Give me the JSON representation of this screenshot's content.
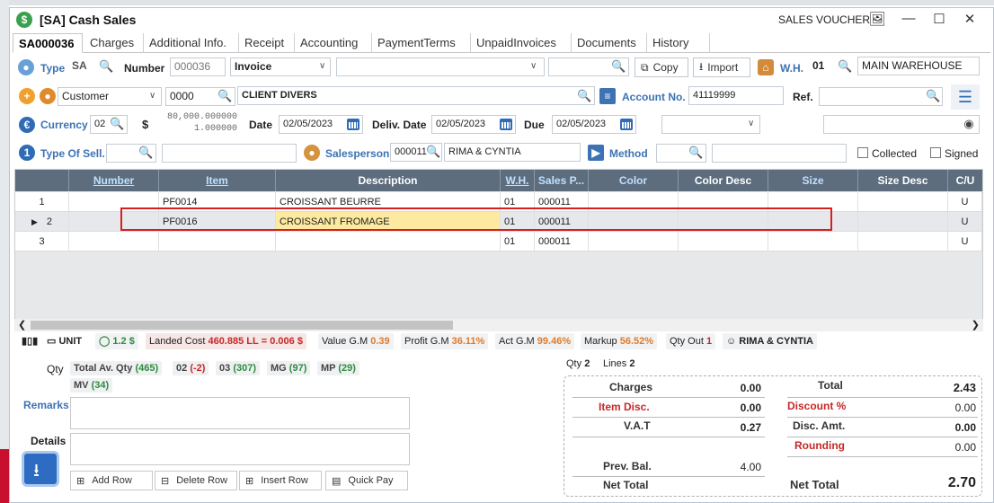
{
  "title": {
    "text": "[SA] Cash Sales",
    "voucher": "SALES VOUCHER"
  },
  "tabs": [
    "SA000036",
    "Charges",
    "Additional Info.",
    "Receipt",
    "Accounting",
    "PaymentTerms",
    "UnpaidInvoices",
    "Documents",
    "History"
  ],
  "form": {
    "type_label": "Type",
    "type_value": "SA",
    "number_label": "Number",
    "number_value": "000036",
    "invoice_value": "Invoice",
    "copy_label": "Copy",
    "import_label": "Import",
    "wh_label": "W.H.",
    "wh_value": "01",
    "wh_name": "MAIN WAREHOUSE",
    "customer_value": "Customer",
    "customer_code": "0000",
    "customer_name": "CLIENT DIVERS",
    "account_label": "Account No.",
    "account_value": "41119999",
    "ref_label": "Ref.",
    "currency_label": "Currency",
    "currency_value": "02",
    "currency_symbol": "$",
    "rate_1": "80,000.000000",
    "rate_2": "1.000000",
    "date_label": "Date",
    "date_value": "02/05/2023",
    "deliv_label": "Deliv. Date",
    "deliv_value": "02/05/2023",
    "due_label": "Due",
    "due_value": "02/05/2023",
    "typesell_label": "Type Of Sell.",
    "salesperson_label": "Salesperson",
    "salesperson_code": "000011",
    "salesperson_name": "RIMA & CYNTIA",
    "method_label": "Method",
    "collected_label": "Collected",
    "signed_label": "Signed"
  },
  "grid": {
    "columns": [
      "",
      "Number",
      "Item",
      "Description",
      "W.H.",
      "Sales P...",
      "Color",
      "Color Desc",
      "Size",
      "Size Desc",
      "C/U"
    ],
    "rows": [
      [
        "1",
        "",
        "PF0014",
        "CROISSANT BEURRE",
        "01",
        "000011",
        "",
        "",
        "",
        "",
        "U"
      ],
      [
        "2",
        "",
        "PF0016",
        "CROISSANT FROMAGE",
        "01",
        "000011",
        "",
        "",
        "",
        "",
        "U"
      ],
      [
        "3",
        "",
        "",
        "",
        "01",
        "000011",
        "",
        "",
        "",
        "",
        "U"
      ]
    ]
  },
  "stats": {
    "unit": "UNIT",
    "units_value": "1.2 $",
    "landed_label": "Landed Cost",
    "landed_value": "460.885 LL",
    "landed_eq": "= 0.006 $",
    "valuegm_label": "Value G.M",
    "valuegm_value": "0.39",
    "profitgm_label": "Profit G.M",
    "profitgm_value": "36.11%",
    "actgm_label": "Act G.M",
    "actgm_value": "99.46%",
    "markup_label": "Markup",
    "markup_value": "56.52%",
    "qtyout_label": "Qty Out",
    "qtyout_value": "1",
    "person": "RIMA & CYNTIA"
  },
  "qty": {
    "label": "Qty",
    "chips": [
      {
        "name": "Total Av. Qty",
        "val": "(465)"
      },
      {
        "name": "02",
        "val": "(-2)"
      },
      {
        "name": "03",
        "val": "(307)"
      },
      {
        "name": "MG",
        "val": "(97)"
      },
      {
        "name": "MP",
        "val": "(29)"
      },
      {
        "name": "MV",
        "val": "(34)"
      }
    ]
  },
  "remarks_label": "Remarks",
  "details_label": "Details",
  "summary": {
    "qty_label": "Qty",
    "qty_value": "2",
    "lines_label": "Lines",
    "lines_value": "2"
  },
  "totals": {
    "charges_label": "Charges",
    "charges": "0.00",
    "itemdisc_label": "Item Disc.",
    "itemdisc": "0.00",
    "vat_label": "V.A.T",
    "vat": "0.27",
    "prevbal_label": "Prev. Bal.",
    "prevbal": "4.00",
    "nettotal_label": "Net Total",
    "total_label": "Total",
    "total": "2.43",
    "discpct_label": "Discount %",
    "discpct": "0.00",
    "discamt_label": "Disc. Amt.",
    "discamt": "0.00",
    "rounding_label": "Rounding",
    "rounding": "0.00",
    "net_label": "Net Total",
    "net": "2.70"
  },
  "buttons": {
    "add_row": "Add Row",
    "delete_row": "Delete Row",
    "insert_row": "Insert Row",
    "quick_pay": "Quick Pay"
  },
  "colors": {
    "header": "#5d6d7e",
    "selection": "#d62020",
    "accent": "#3d72b4"
  }
}
